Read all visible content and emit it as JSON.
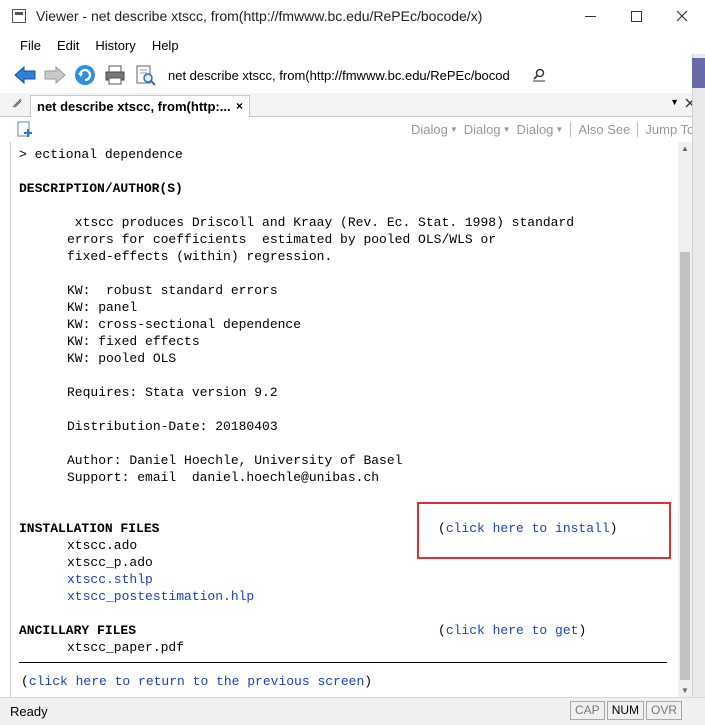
{
  "window": {
    "title": "Viewer - net describe xtscc, from(http://fmwww.bc.edu/RePEc/bocode/x)"
  },
  "menu": [
    "File",
    "Edit",
    "History",
    "Help"
  ],
  "toolbar": {
    "address": "net describe xtscc, from(http://fmwww.bc.edu/RePEc/bocod"
  },
  "tab": {
    "label": "net describe xtscc, from(http:...",
    "close": "×"
  },
  "viewer_toolbar": {
    "buttons": [
      "Dialog",
      "Dialog",
      "Dialog",
      "Also See",
      "Jump To"
    ]
  },
  "content": {
    "lines": {
      "l0": "> ectional dependence",
      "h_desc": "DESCRIPTION/AUTHOR(S)",
      "d1": " xtscc produces Driscoll and Kraay (Rev. Ec. Stat. 1998) standard",
      "d2": "errors for coefficients  estimated by pooled OLS/WLS or",
      "d3": "fixed-effects (within) regression.",
      "kw1": "KW:  robust standard errors",
      "kw2": "KW: panel",
      "kw3": "KW: cross-sectional dependence",
      "kw4": "KW: fixed effects",
      "kw5": "KW: pooled OLS",
      "req": "Requires: Stata version 9.2",
      "dist": "Distribution-Date: 20180403",
      "author": "Author: Daniel Hoechle, University of Basel",
      "support": "Support: email  daniel.hoechle@unibas.ch",
      "h_install": "INSTALLATION FILES",
      "install_link": "click here to install",
      "f1": "xtscc.ado",
      "f2": "xtscc_p.ado",
      "f3": "xtscc.sthlp",
      "f4": "xtscc_postestimation.hlp",
      "h_anc": "ANCILLARY FILES",
      "get_link": "click here to get",
      "a1": "xtscc_paper.pdf",
      "return_link": "click here to return to the previous screen"
    }
  },
  "status": {
    "text": "Ready",
    "indicators": [
      "CAP",
      "NUM",
      "OVR"
    ]
  },
  "colors": {
    "link": "#1a3fcc",
    "highlight_box": "#e03030"
  }
}
